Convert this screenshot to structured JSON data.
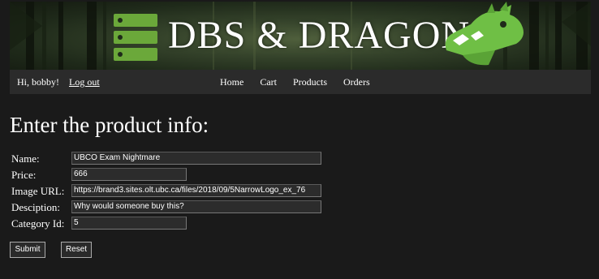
{
  "banner": {
    "title": "DBS & DRAGONS",
    "logo_icon": "database-stack-icon",
    "mascot_icon": "dragon-icon",
    "colors": {
      "logo_green": "#6ba83a",
      "dragon_green": "#6fbf45",
      "forest_dark": "#1f2a1a"
    }
  },
  "nav": {
    "greeting": "Hi, bobby!",
    "logout": "Log out",
    "links": {
      "home": "Home",
      "cart": "Cart",
      "products": "Products",
      "orders": "Orders"
    }
  },
  "page": {
    "heading": "Enter the product info:"
  },
  "form": {
    "name": {
      "label": "Name:",
      "value": "UBCO Exam Nightmare"
    },
    "price": {
      "label": "Price:",
      "value": "666"
    },
    "image_url": {
      "label": "Image URL:",
      "value": "https://brand3.sites.olt.ubc.ca/files/2018/09/5NarrowLogo_ex_76"
    },
    "description": {
      "label": "Desciption:",
      "value": "Why would someone buy this?"
    },
    "category_id": {
      "label": "Category Id:",
      "value": "5"
    },
    "submit": "Submit",
    "reset": "Reset"
  }
}
